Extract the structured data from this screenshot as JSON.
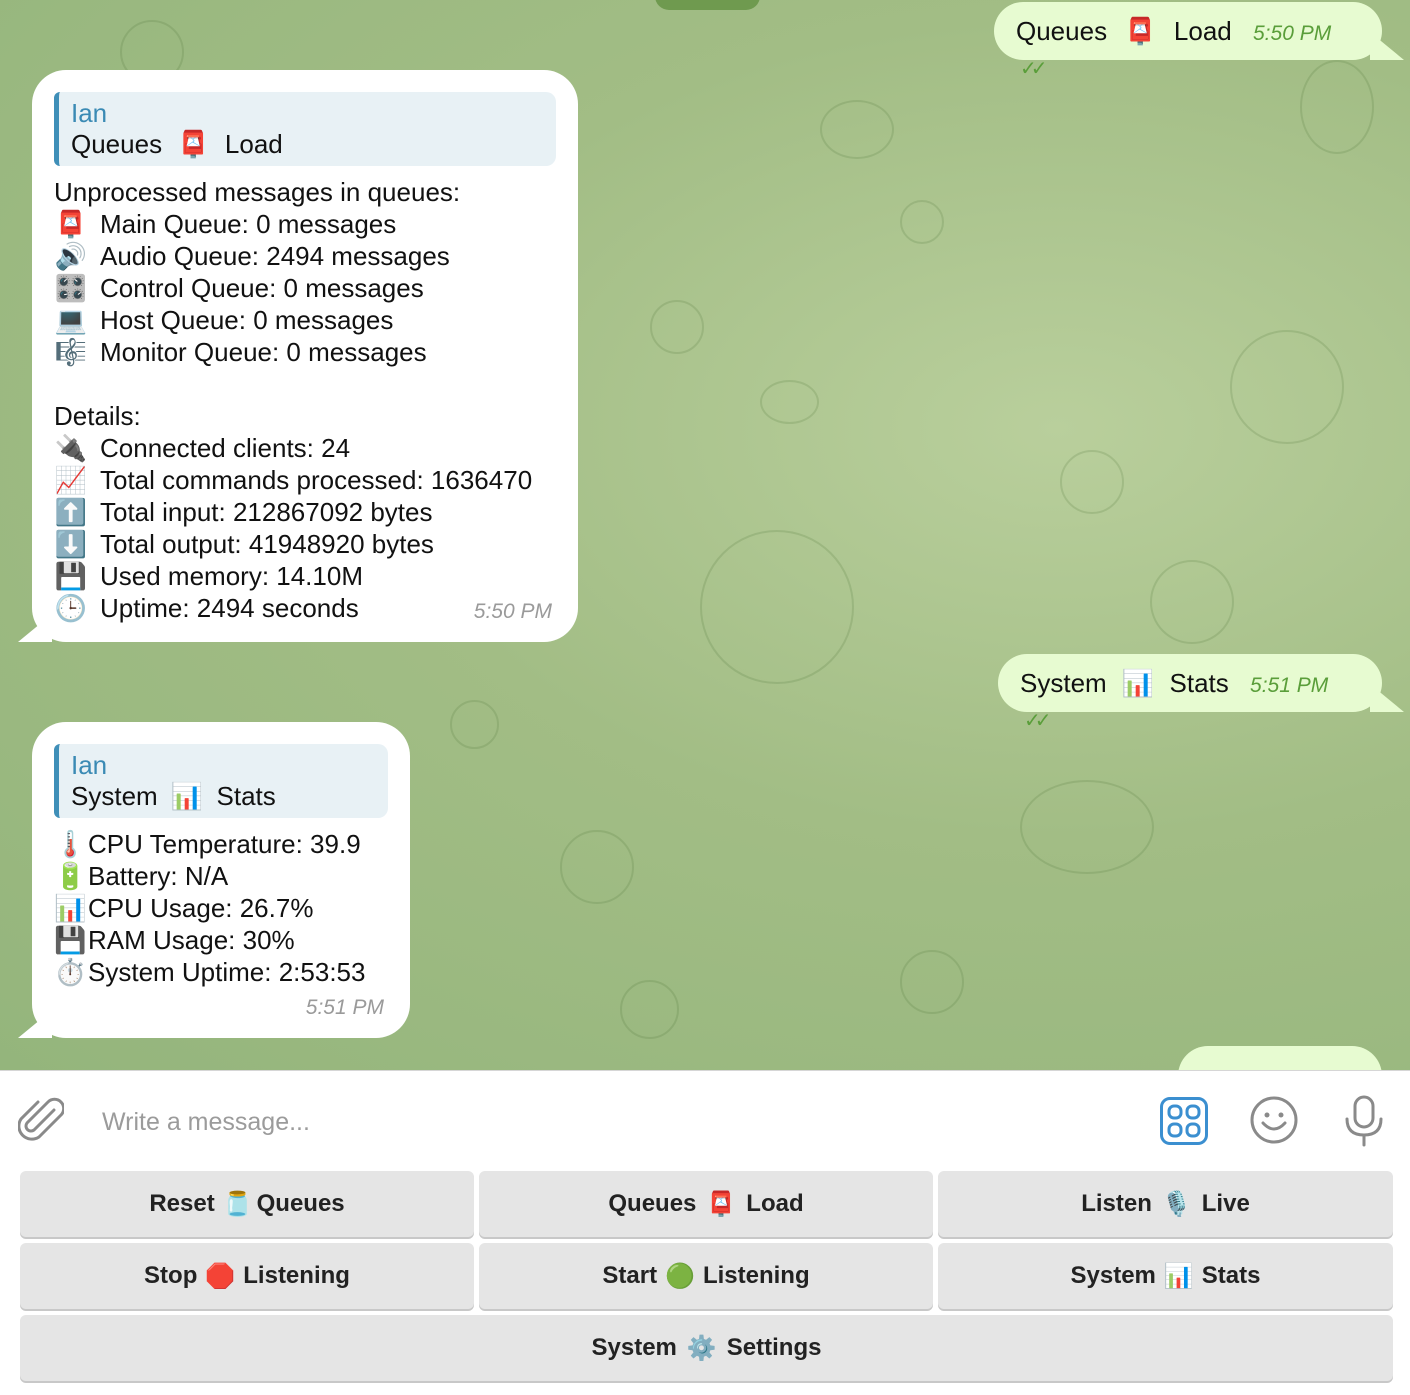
{
  "chat": {
    "sent1": {
      "text_a": "Queues",
      "emoji": "📮",
      "text_b": "Load",
      "time": "5:50 PM",
      "status": "✓✓"
    },
    "msg1": {
      "reply_name": "Ian",
      "reply_text_a": "Queues",
      "reply_emoji": "📮",
      "reply_text_b": "Load",
      "header": "Unprocessed messages in queues:",
      "queues": [
        {
          "emoji": "📮",
          "text": "Main Queue: 0 messages"
        },
        {
          "emoji": "🔊",
          "text": "Audio Queue: 2494 messages"
        },
        {
          "emoji": "🎛️",
          "text": "Control Queue: 0 messages"
        },
        {
          "emoji": "💻",
          "text": "Host Queue: 0 messages"
        },
        {
          "emoji": "🎼",
          "text": "Monitor Queue: 0 messages"
        }
      ],
      "details_header": "Details:",
      "details": [
        {
          "emoji": "🔌",
          "text": "Connected clients: 24"
        },
        {
          "emoji": "📈",
          "text": "Total commands processed: 1636470"
        },
        {
          "emoji": "⬆️",
          "text": "Total input: 212867092 bytes"
        },
        {
          "emoji": "⬇️",
          "text": "Total output: 41948920 bytes"
        },
        {
          "emoji": "💾",
          "text": "Used memory: 14.10M"
        },
        {
          "emoji": "🕒",
          "text": "Uptime: 2494 seconds"
        }
      ],
      "time": "5:50 PM"
    },
    "sent2": {
      "text_a": "System",
      "emoji": "📊",
      "text_b": "Stats",
      "time": "5:51 PM",
      "status": "✓✓"
    },
    "msg2": {
      "reply_name": "Ian",
      "reply_text_a": "System",
      "reply_emoji": "📊",
      "reply_text_b": "Stats",
      "stats": [
        {
          "emoji": "🌡️",
          "text": "CPU Temperature: 39.9"
        },
        {
          "emoji": "🔋",
          "text": "Battery: N/A"
        },
        {
          "emoji": "📊",
          "text": "CPU Usage: 26.7%"
        },
        {
          "emoji": "💾",
          "text": "RAM Usage: 30%"
        },
        {
          "emoji": "⏱️",
          "text": "System Uptime: 2:53:53"
        }
      ],
      "time": "5:51 PM"
    }
  },
  "composer": {
    "placeholder": "Write a message...",
    "icons": [
      "paperclip-icon",
      "bot-commands-icon",
      "emoji-icon",
      "microphone-icon"
    ]
  },
  "keyboard": {
    "buttons": [
      {
        "a": "Reset",
        "emoji": "🫙",
        "b": "Queues"
      },
      {
        "a": "Queues",
        "emoji": "📮",
        "b": "Load"
      },
      {
        "a": "Listen",
        "emoji": "🎙️",
        "b": "Live"
      },
      {
        "a": "Stop",
        "emoji": "🛑",
        "b": "Listening"
      },
      {
        "a": "Start",
        "emoji": "🟢",
        "b": "Listening"
      },
      {
        "a": "System",
        "emoji": "📊",
        "b": "Stats"
      },
      {
        "a": "System",
        "emoji": "⚙️",
        "b": "Settings"
      }
    ]
  },
  "colors": {
    "outgoing_bubble": "#e7fbd1",
    "incoming_bubble": "#ffffff",
    "accent": "#3a8ab4",
    "background": "#a2bd85"
  }
}
